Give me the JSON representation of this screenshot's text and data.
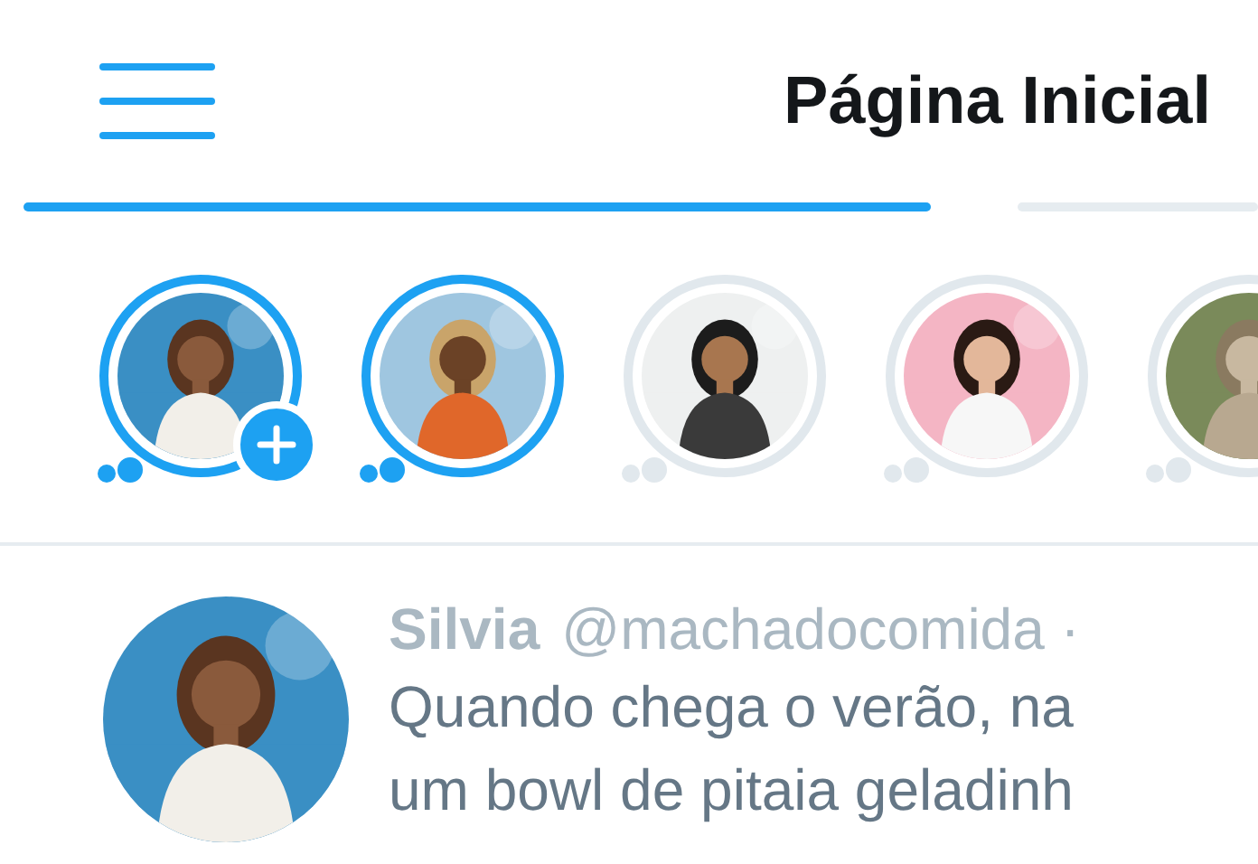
{
  "header": {
    "title": "Página Inicial"
  },
  "tabs": [
    {
      "selected": true
    },
    {
      "selected": false
    }
  ],
  "stories": [
    {
      "seen": false,
      "kind": "own"
    },
    {
      "seen": false,
      "kind": "friend"
    },
    {
      "seen": true,
      "kind": "friend"
    },
    {
      "seen": true,
      "kind": "friend"
    },
    {
      "seen": true,
      "kind": "friend"
    }
  ],
  "tweet": {
    "name": "Silvia",
    "handle": "@machadocomida ·",
    "lines": [
      "Quando chega o verão, na",
      "um bowl de pitaia geladinh"
    ]
  }
}
